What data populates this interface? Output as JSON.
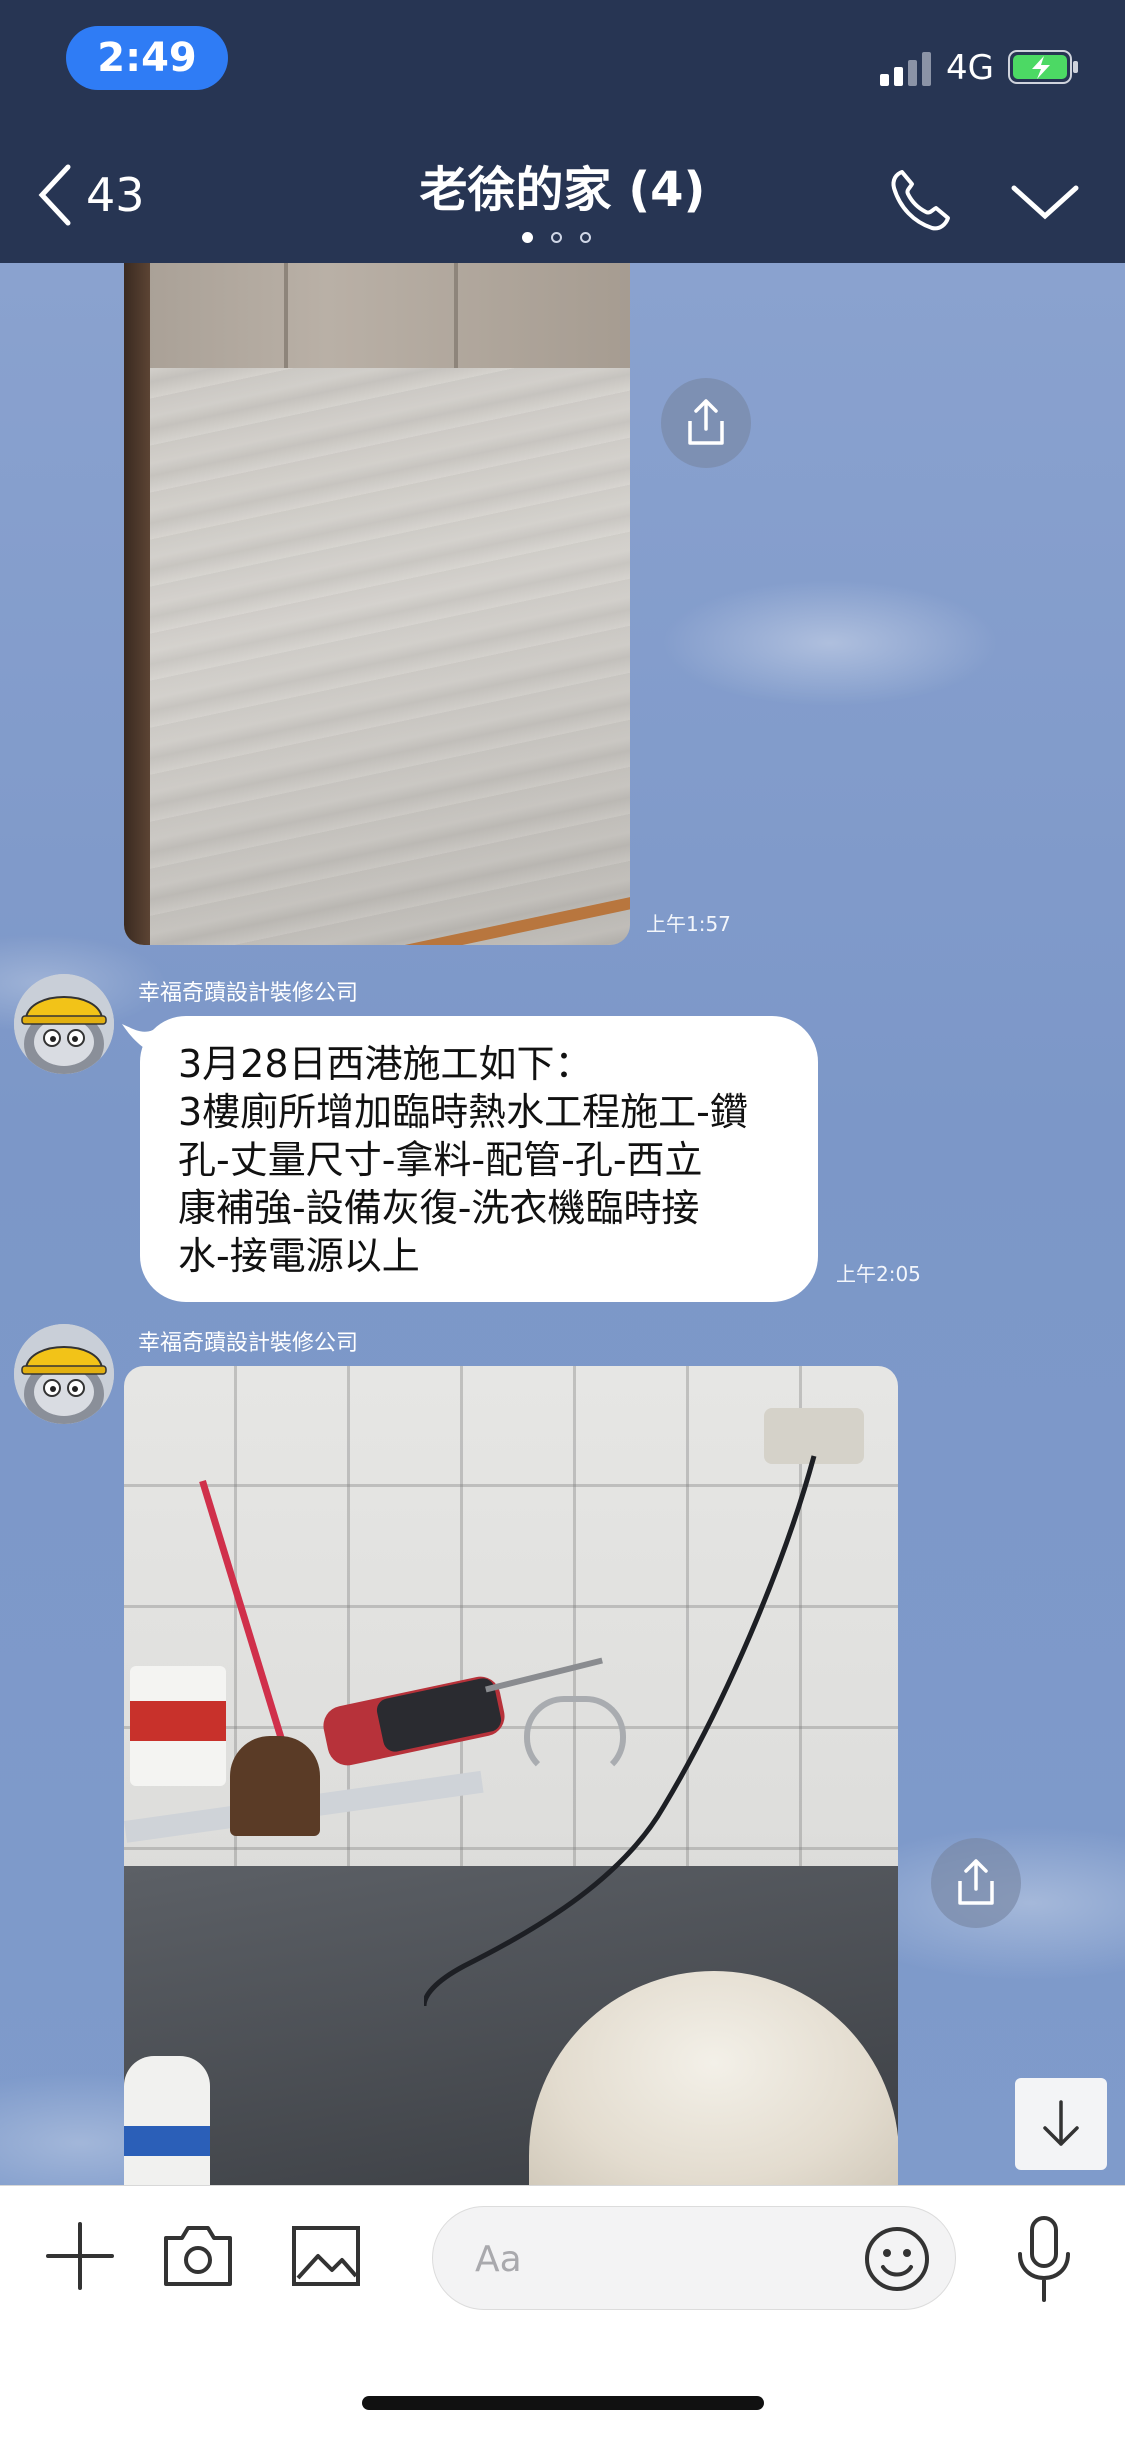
{
  "status_bar": {
    "time": "2:49",
    "network": "4G"
  },
  "header": {
    "back_count": "43",
    "title": "老徐的家 (4)"
  },
  "messages": {
    "m1": {
      "time": "上午1:57"
    },
    "m2": {
      "sender": "幸福奇蹟設計裝修公司",
      "lines": [
        "3月28日西港施工如下：",
        "3樓廁所增加臨時熱水工程施工-鑽",
        "孔-丈量尺寸-拿料-配管-孔-西立",
        "康補強-設備灰復-洗衣機臨時接",
        "水-接電源以上"
      ],
      "time": "上午2:05"
    },
    "m3": {
      "sender": "幸福奇蹟設計裝修公司"
    }
  },
  "composer": {
    "placeholder": "Aa"
  },
  "colors": {
    "header_bg": "#273553",
    "time_pill": "#2f7cf5",
    "chat_bg": "#7e98c8"
  }
}
